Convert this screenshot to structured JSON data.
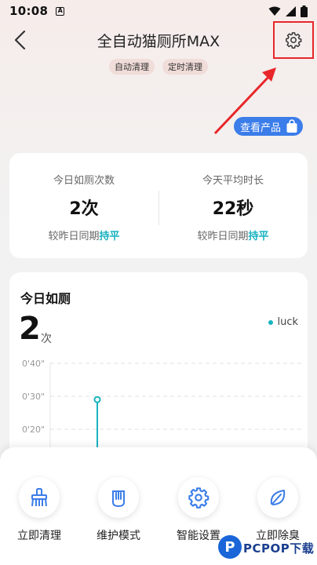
{
  "status_bar": {
    "time": "10:08",
    "app_badge": "A"
  },
  "header": {
    "title": "全自动猫厕所MAX",
    "tags": [
      "自动清理",
      "定时清理"
    ],
    "view_product_label": "查看产品"
  },
  "stats": {
    "left": {
      "label": "今日如厕次数",
      "value": "2次",
      "compare_prefix": "较昨日同期",
      "compare_value": "持平"
    },
    "right": {
      "label": "今天平均时长",
      "value": "22秒",
      "compare_prefix": "较昨日同期",
      "compare_value": "持平"
    }
  },
  "chart_card": {
    "title": "今日如厕",
    "count": "2",
    "unit": "次",
    "legend": "luck"
  },
  "chart_data": {
    "type": "scatter",
    "series": [
      {
        "name": "luck",
        "color": "#18b3bf",
        "values": [
          {
            "y_seconds": 29
          }
        ]
      }
    ],
    "y_ticks": [
      "0'40\"",
      "0'30\"",
      "0'20\""
    ],
    "ylim": [
      20,
      40
    ],
    "grid": true
  },
  "actions": [
    {
      "label": "立即清理",
      "icon": "broom-icon"
    },
    {
      "label": "维护模式",
      "icon": "hand-icon"
    },
    {
      "label": "智能设置",
      "icon": "gear-icon"
    },
    {
      "label": "立即除臭",
      "icon": "leaf-icon"
    }
  ],
  "watermark": {
    "letter": "P",
    "text": "PCPOP下载"
  },
  "colors": {
    "accent": "#18b3bf",
    "primary_blue": "#3b7de9",
    "highlight_red": "#e8262a"
  }
}
